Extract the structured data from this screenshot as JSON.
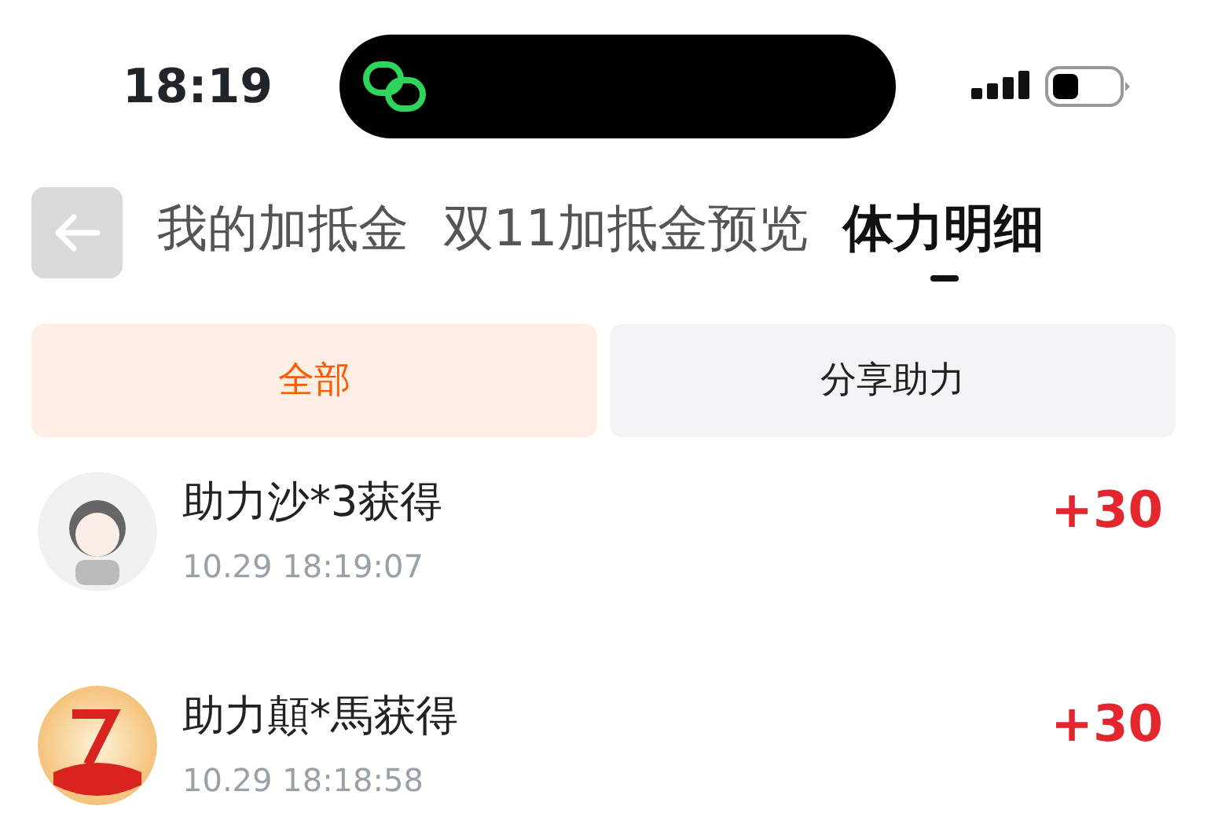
{
  "status_bar": {
    "time": "18:19"
  },
  "tabs": [
    {
      "label": "我的加抵金",
      "selected": false
    },
    {
      "label": "双11加抵金预览",
      "selected": false
    },
    {
      "label": "体力明细",
      "selected": true
    }
  ],
  "filters": [
    {
      "label": "全部",
      "selected": true
    },
    {
      "label": "分享助力",
      "selected": false
    }
  ],
  "records": [
    {
      "title": "助力沙*3获得",
      "time": "10.29 18:19:07",
      "amount": "+30",
      "kind": "cartoon"
    },
    {
      "title": "助力顛*馬获得",
      "time": "10.29 18:18:58",
      "amount": "+30",
      "kind": "emblem"
    }
  ]
}
